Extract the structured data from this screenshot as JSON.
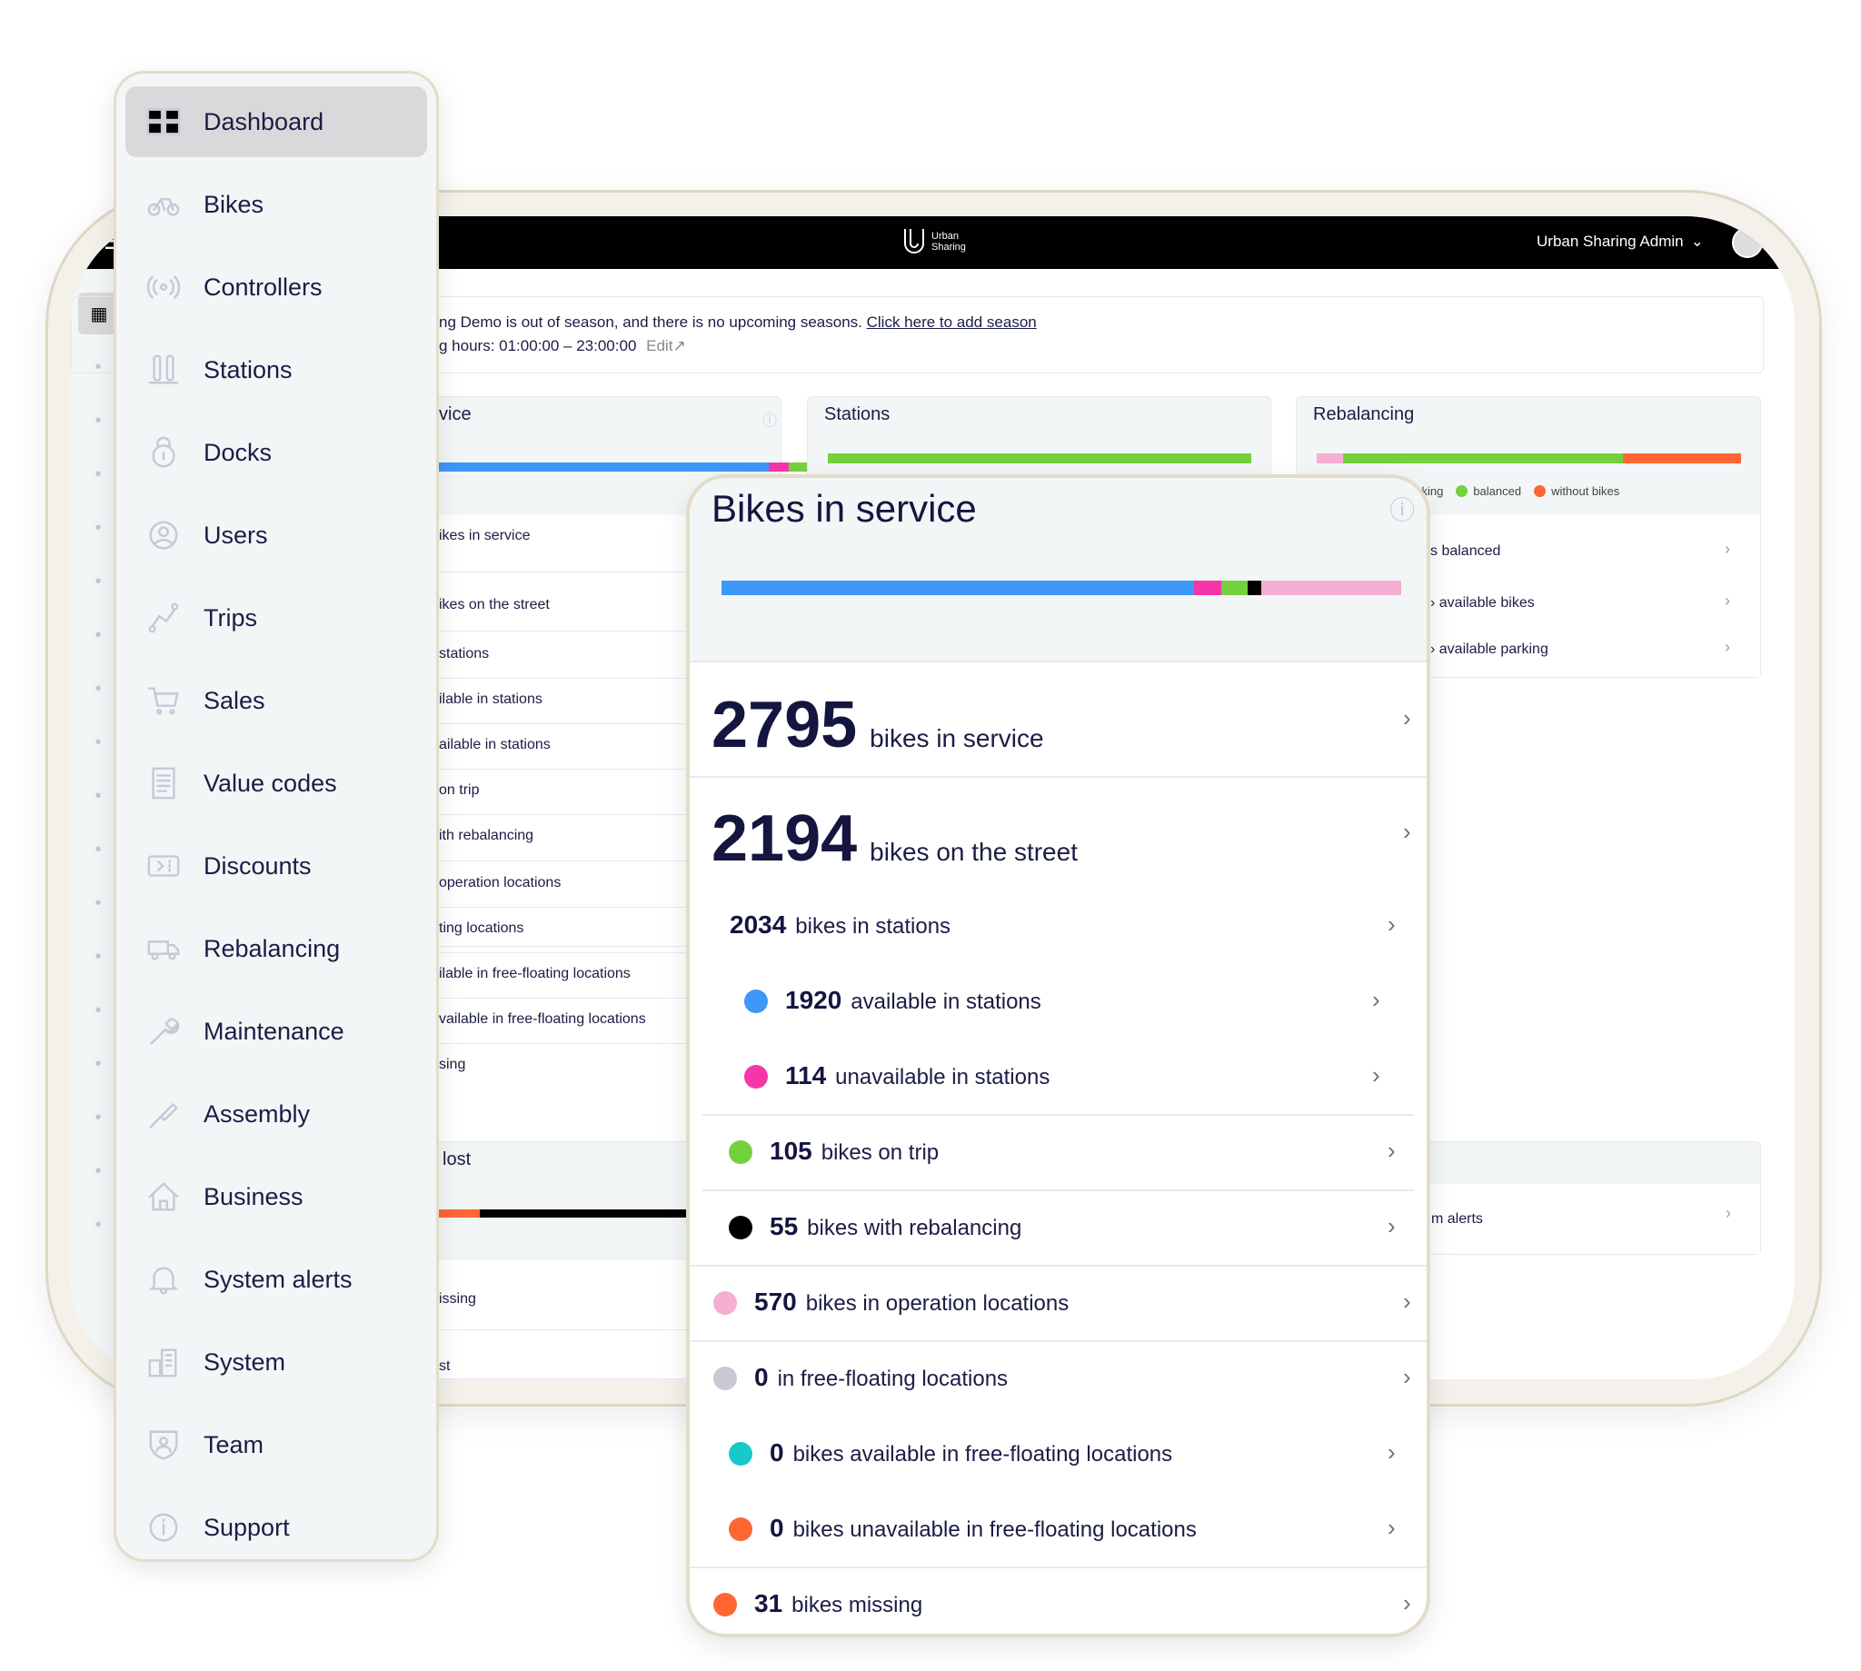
{
  "header": {
    "logo_text": "Urban Sharing",
    "user_menu": "Urban Sharing Admin",
    "user_menu_icon": "chevron-down-icon"
  },
  "notice": {
    "line1": "ng Demo is out of season, and there is no upcoming seasons.",
    "link": "Click here to add season",
    "line2": "g hours: 01:00:00 – 23:00:00",
    "edit": "Edit"
  },
  "sidebar": {
    "items": [
      {
        "label": "Dashboard",
        "icon": "dashboard-icon",
        "active": true
      },
      {
        "label": "Bikes",
        "icon": "bike-icon"
      },
      {
        "label": "Controllers",
        "icon": "signal-icon"
      },
      {
        "label": "Stations",
        "icon": "station-icon"
      },
      {
        "label": "Docks",
        "icon": "lock-icon"
      },
      {
        "label": "Users",
        "icon": "user-icon"
      },
      {
        "label": "Trips",
        "icon": "route-icon"
      },
      {
        "label": "Sales",
        "icon": "cart-icon"
      },
      {
        "label": "Value codes",
        "icon": "receipt-icon"
      },
      {
        "label": "Discounts",
        "icon": "discount-icon"
      },
      {
        "label": "Rebalancing",
        "icon": "truck-icon"
      },
      {
        "label": "Maintenance",
        "icon": "wrench-icon"
      },
      {
        "label": "Assembly",
        "icon": "screwdriver-icon"
      },
      {
        "label": "Business",
        "icon": "house-icon"
      },
      {
        "label": "System alerts",
        "icon": "bell-icon"
      },
      {
        "label": "System",
        "icon": "building-icon"
      },
      {
        "label": "Team",
        "icon": "shield-user-icon"
      },
      {
        "label": "Support",
        "icon": "info-icon"
      }
    ]
  },
  "background": {
    "service_card": {
      "title": "vice",
      "rows": [
        "ikes in service",
        "ikes on the street",
        "stations",
        "ilable in stations",
        "ailable in stations",
        "on trip",
        "ith rebalancing",
        "operation locations",
        "ting locations",
        "ilable in free-floating locations",
        "vailable in free-floating locations",
        "sing"
      ]
    },
    "lost_card": {
      "title": "lost",
      "rows": [
        "issing",
        "st"
      ]
    },
    "stations_card": {
      "title": "Stations"
    },
    "rebalancing_card": {
      "title": "Rebalancing",
      "legend": [
        "out parking",
        "balanced",
        "without bikes"
      ],
      "rows": [
        "s balanced",
        "› available bikes",
        "› available parking"
      ]
    },
    "alerts_card": {
      "rows": [
        "m alerts"
      ]
    }
  },
  "colors": {
    "available": "#3d98f7",
    "unavailable": "#f536a8",
    "on_trip": "#74d13e",
    "rebalancing": "#000000",
    "operation": "#f4afd3",
    "free_floating": "#c9c9d3",
    "ff_available": "#18c9c9",
    "ff_unavailable": "#ff6633",
    "missing": "#ff6633"
  },
  "bikes_card": {
    "title": "Bikes in service",
    "info_icon": "info-icon",
    "bar": [
      {
        "value": 1920,
        "color": "#3d98f7"
      },
      {
        "value": 114,
        "color": "#f536a8"
      },
      {
        "value": 105,
        "color": "#74d13e"
      },
      {
        "value": 55,
        "color": "#000000"
      },
      {
        "value": 570,
        "color": "#f4afd3"
      }
    ],
    "rows": [
      {
        "value": "2795",
        "label": "bikes in service",
        "big": true
      },
      {
        "value": "2194",
        "label": "bikes on the street",
        "big": true
      },
      {
        "value": "2034",
        "label": "bikes in stations",
        "level": 1
      },
      {
        "value": "1920",
        "label": "available in stations",
        "level": 2,
        "dot": "#3d98f7"
      },
      {
        "value": "114",
        "label": "unavailable in stations",
        "level": 2,
        "dot": "#f536a8"
      },
      {
        "value": "105",
        "label": "bikes on trip",
        "level": 1,
        "dot": "#74d13e"
      },
      {
        "value": "55",
        "label": "bikes with rebalancing",
        "level": 1,
        "dot": "#000000"
      },
      {
        "value": "570",
        "label": "bikes in operation locations",
        "level": 0,
        "dot": "#f4afd3"
      },
      {
        "value": "0",
        "label": "in free-floating locations",
        "level": 0,
        "dot": "#c9c9d3"
      },
      {
        "value": "0",
        "label": "bikes available in free-floating locations",
        "level": 1,
        "dot": "#18c9c9"
      },
      {
        "value": "0",
        "label": "bikes unavailable in free-floating locations",
        "level": 1,
        "dot": "#ff6633"
      },
      {
        "value": "31",
        "label": "bikes missing",
        "level": 0,
        "dot": "#ff6633"
      }
    ]
  }
}
